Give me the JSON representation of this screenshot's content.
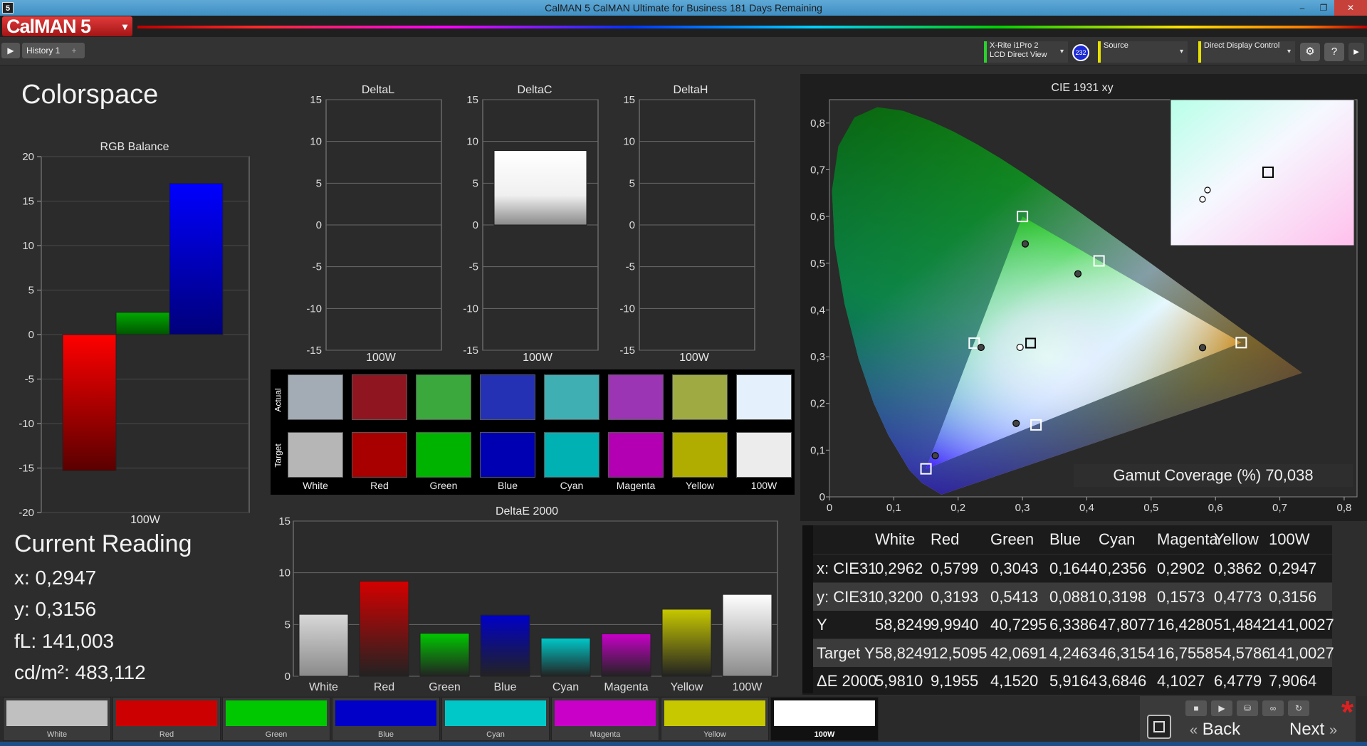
{
  "window": {
    "app_icon": "5",
    "title": "CalMAN 5 CalMAN Ultimate for Business 181 Days Remaining",
    "minimize": "–",
    "maximize": "❐",
    "close": "✕"
  },
  "header": {
    "logo": "CalMAN 5",
    "logo_menu": "▾"
  },
  "toolbar": {
    "play": "▶",
    "history_tab": "History 1",
    "add_tab": "+",
    "meter_line1": "X-Rite i1Pro 2",
    "meter_line2": "LCD Direct View",
    "meter_badge": "232",
    "source_label": "Source",
    "display_label": "Direct Display Control",
    "settings_icon": "⚙",
    "help_icon": "?",
    "dropdown_chevron": "▾",
    "side_chevron": "▸"
  },
  "page": {
    "title": "Colorspace"
  },
  "rgb_balance": {
    "title": "RGB Balance",
    "xlabel": "100W",
    "ticks": [
      "20",
      "15",
      "10",
      "5",
      "0",
      "-5",
      "-10",
      "-15",
      "-20"
    ]
  },
  "delta_charts": [
    {
      "title": "DeltaL",
      "xlabel": "100W"
    },
    {
      "title": "DeltaC",
      "xlabel": "100W"
    },
    {
      "title": "DeltaH",
      "xlabel": "100W"
    }
  ],
  "delta_ticks": [
    "15",
    "10",
    "5",
    "0",
    "-5",
    "-10",
    "-15"
  ],
  "swatches": {
    "actual_label": "Actual",
    "target_label": "Target",
    "items": [
      {
        "name": "White",
        "actual": "#a3acb4",
        "target": "#b6b6b6"
      },
      {
        "name": "Red",
        "actual": "#8f1520",
        "target": "#a80000"
      },
      {
        "name": "Green",
        "actual": "#3aa83c",
        "target": "#00b300"
      },
      {
        "name": "Blue",
        "actual": "#2431b4",
        "target": "#0000b3"
      },
      {
        "name": "Cyan",
        "actual": "#3fafb4",
        "target": "#00b1b3"
      },
      {
        "name": "Magenta",
        "actual": "#9b35b4",
        "target": "#b300b3"
      },
      {
        "name": "Yellow",
        "actual": "#9fab42",
        "target": "#b0ad00"
      },
      {
        "name": "100W",
        "actual": "#e4f0fc",
        "target": "#ececec"
      }
    ]
  },
  "deltae_title": "DeltaE 2000",
  "deltae_ticks": [
    "15",
    "10",
    "5",
    "0"
  ],
  "cie": {
    "title": "CIE 1931 xy",
    "gamut_label": "Gamut Coverage (%) 70,038",
    "x_ticks": [
      "0",
      "0,1",
      "0,2",
      "0,3",
      "0,4",
      "0,5",
      "0,6",
      "0,7",
      "0,8"
    ],
    "y_ticks": [
      "0",
      "0,1",
      "0,2",
      "0,3",
      "0,4",
      "0,5",
      "0,6",
      "0,7",
      "0,8"
    ]
  },
  "current_reading": {
    "title": "Current Reading",
    "x": "x: 0,2947",
    "y": "y: 0,3156",
    "fl": "fL: 141,003",
    "cdm2": "cd/m²: 483,112"
  },
  "table": {
    "columns": [
      "White",
      "Red",
      "Green",
      "Blue",
      "Cyan",
      "Magenta",
      "Yellow",
      "100W"
    ],
    "rows": [
      {
        "label": "x: CIE31",
        "values": [
          "0,2962",
          "0,5799",
          "0,3043",
          "0,1644",
          "0,2356",
          "0,2902",
          "0,3862",
          "0,2947"
        ]
      },
      {
        "label": "y: CIE31",
        "values": [
          "0,3200",
          "0,3193",
          "0,5413",
          "0,0881",
          "0,3198",
          "0,1573",
          "0,4773",
          "0,3156"
        ]
      },
      {
        "label": "Y",
        "values": [
          "58,8249",
          "9,9940",
          "40,7295",
          "6,3386",
          "47,8077",
          "16,4280",
          "51,4842",
          "141,0027"
        ]
      },
      {
        "label": "Target Y",
        "values": [
          "58,8249",
          "12,5095",
          "42,0691",
          "4,2463",
          "46,3154",
          "16,7558",
          "54,5786",
          "141,0027"
        ]
      },
      {
        "label": "ΔE 2000",
        "values": [
          "5,9810",
          "9,1955",
          "4,1520",
          "5,9164",
          "3,6846",
          "4,1027",
          "6,4779",
          "7,9064"
        ]
      }
    ]
  },
  "bottom_swatches": [
    {
      "label": "White",
      "color": "#c0c0c0"
    },
    {
      "label": "Red",
      "color": "#cc0000"
    },
    {
      "label": "Green",
      "color": "#00c800"
    },
    {
      "label": "Blue",
      "color": "#0000c8"
    },
    {
      "label": "Cyan",
      "color": "#00c8c8"
    },
    {
      "label": "Magenta",
      "color": "#c800c8"
    },
    {
      "label": "Yellow",
      "color": "#c8c800"
    },
    {
      "label": "100W",
      "color": "#ffffff"
    }
  ],
  "nav": {
    "back": "Back",
    "next": "Next",
    "back_icon": "«",
    "next_icon": "»",
    "stop_icon": "■",
    "asterisk": "*"
  },
  "chart_data": [
    {
      "type": "bar",
      "title": "RGB Balance",
      "categories": [
        "100W"
      ],
      "series": [
        {
          "name": "Red",
          "values": [
            -15.3
          ],
          "color": "#ff0000"
        },
        {
          "name": "Green",
          "values": [
            2.5
          ],
          "color": "#00aa00"
        },
        {
          "name": "Blue",
          "values": [
            17.0
          ],
          "color": "#0000ff"
        }
      ],
      "ylim": [
        -20,
        20
      ]
    },
    {
      "type": "bar",
      "title": "DeltaL",
      "categories": [
        "100W"
      ],
      "values": [
        0
      ],
      "ylim": [
        -15,
        15
      ]
    },
    {
      "type": "bar",
      "title": "DeltaC",
      "categories": [
        "100W"
      ],
      "values": [
        8.9
      ],
      "ylim": [
        -15,
        15
      ]
    },
    {
      "type": "bar",
      "title": "DeltaH",
      "categories": [
        "100W"
      ],
      "values": [
        0
      ],
      "ylim": [
        -15,
        15
      ]
    },
    {
      "type": "bar",
      "title": "DeltaE 2000",
      "categories": [
        "White",
        "Red",
        "Green",
        "Blue",
        "Cyan",
        "Magenta",
        "Yellow",
        "100W"
      ],
      "values": [
        5.981,
        9.1955,
        4.152,
        5.9164,
        3.6846,
        4.1027,
        6.4779,
        7.9064
      ],
      "colors": [
        "#d8d8d8",
        "#d40000",
        "#00c800",
        "#0000c8",
        "#00c8c8",
        "#c800c8",
        "#c8c800",
        "#ffffff"
      ],
      "ylim": [
        0,
        15
      ]
    },
    {
      "type": "scatter",
      "title": "CIE 1931 xy",
      "xlim": [
        0,
        0.8
      ],
      "ylim": [
        0,
        0.8
      ],
      "targets": [
        {
          "name": "Red",
          "x": 0.64,
          "y": 0.33
        },
        {
          "name": "Green",
          "x": 0.3,
          "y": 0.6
        },
        {
          "name": "Blue",
          "x": 0.15,
          "y": 0.06
        },
        {
          "name": "Cyan",
          "x": 0.225,
          "y": 0.329
        },
        {
          "name": "Magenta",
          "x": 0.321,
          "y": 0.154
        },
        {
          "name": "Yellow",
          "x": 0.419,
          "y": 0.505
        },
        {
          "name": "White",
          "x": 0.3127,
          "y": 0.329
        }
      ],
      "measured": [
        {
          "name": "White",
          "x": 0.2962,
          "y": 0.32
        },
        {
          "name": "Red",
          "x": 0.5799,
          "y": 0.3193
        },
        {
          "name": "Green",
          "x": 0.3043,
          "y": 0.5413
        },
        {
          "name": "Blue",
          "x": 0.1644,
          "y": 0.0881
        },
        {
          "name": "Cyan",
          "x": 0.2356,
          "y": 0.3198
        },
        {
          "name": "Magenta",
          "x": 0.2902,
          "y": 0.1573
        },
        {
          "name": "Yellow",
          "x": 0.3862,
          "y": 0.4773
        }
      ]
    }
  ]
}
